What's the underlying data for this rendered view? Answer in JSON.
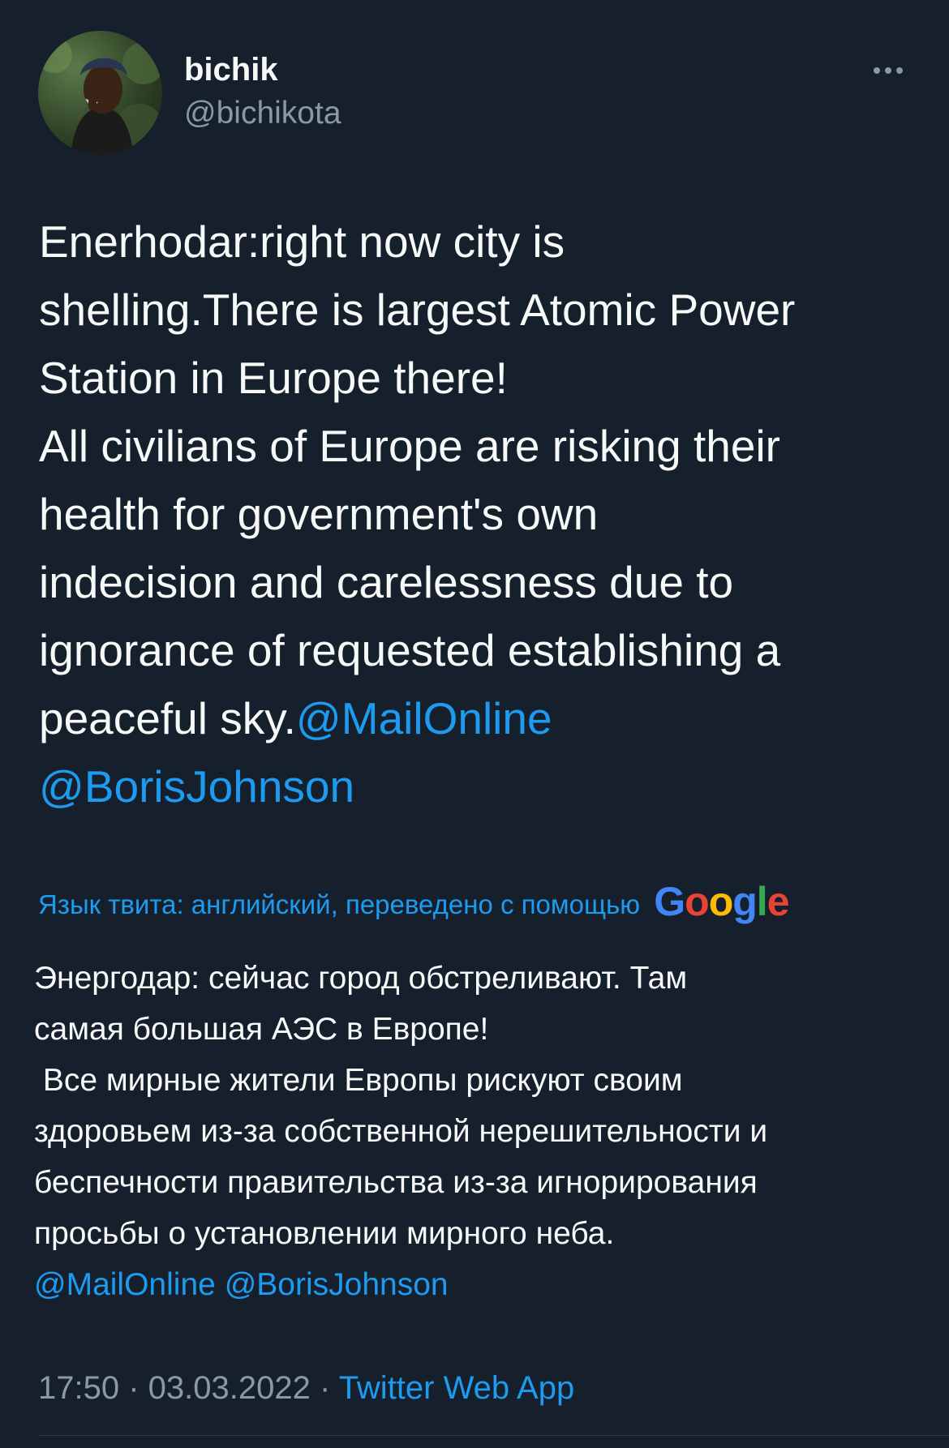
{
  "author": {
    "display_name": "bichik",
    "handle": "@bichikota"
  },
  "icons": {
    "avatar": "profile-photo",
    "more": "ellipsis-horizontal-icon",
    "translator_logo": "google-logo"
  },
  "tweet": {
    "lines": [
      "Enerhodar:right now city is",
      "shelling.There is largest Atomic Power",
      "Station in Europe there!",
      "All civilians of Europe are risking their",
      "health for government's own",
      "indecision and carelessness due to",
      "ignorance of requested establishing a"
    ],
    "last_line_text": "peaceful sky.",
    "mention_1": "@MailOnline",
    "mention_2": "@BorisJohnson"
  },
  "translation": {
    "notice": "Язык твита: английский, переведено с помощью",
    "provider": "Google",
    "provider_letters": [
      "G",
      "o",
      "o",
      "g",
      "l",
      "e"
    ],
    "provider_colors": [
      "#4285F4",
      "#EA4335",
      "#FBBC05",
      "#4285F4",
      "#34A853",
      "#EA4335"
    ],
    "lines": [
      "Энергодар: сейчас город обстреливают. Там",
      "самая большая АЭС в Европе!",
      " Все мирные жители Европы рискуют своим",
      "здоровьем из-за собственной нерешительности и",
      "беспечности правительства из-за игнорирования",
      "просьбы о установлении мирного неба."
    ],
    "mention_1": "@MailOnline",
    "mention_2": "@BorisJohnson"
  },
  "meta": {
    "time": "17:50",
    "separator": " · ",
    "date": "03.03.2022",
    "source": "Twitter Web App"
  },
  "colors": {
    "background": "#16202c",
    "text": "#f7f9f9",
    "secondary": "#8b98a5",
    "link": "#1d9bf0"
  }
}
